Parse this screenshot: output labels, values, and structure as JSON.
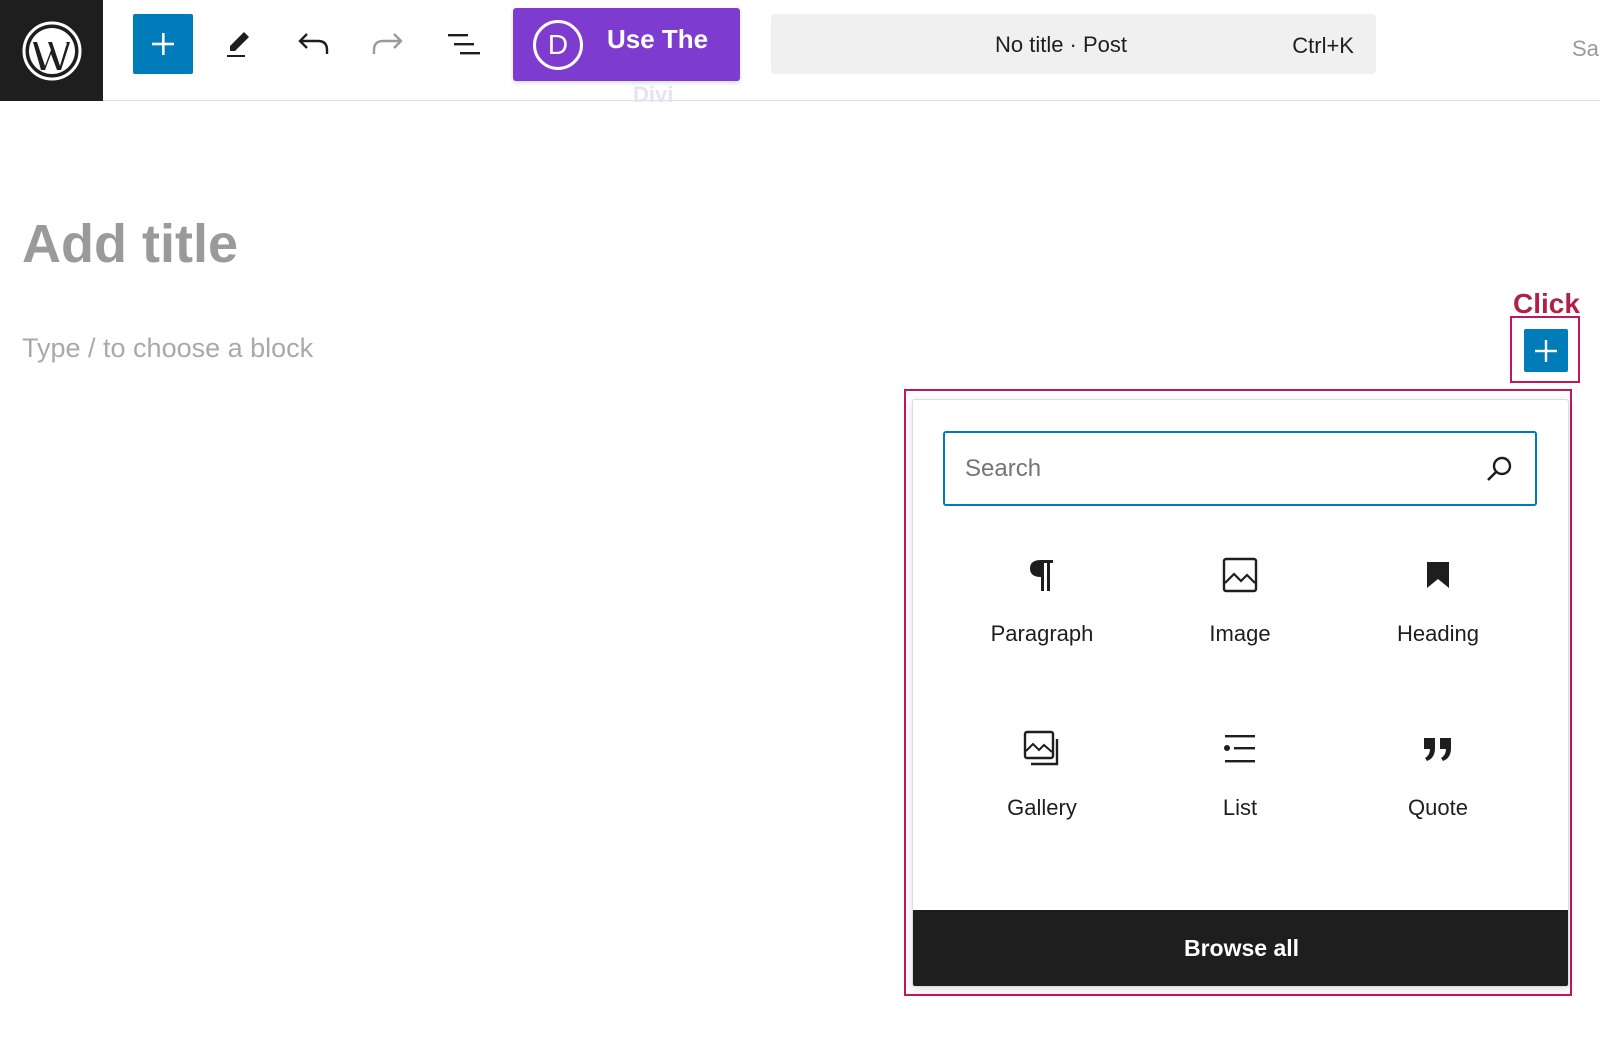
{
  "topbar": {
    "add_block_icon": "plus-icon",
    "tools_icon": "pencil-icon",
    "undo_icon": "undo-icon",
    "redo_icon": "redo-icon",
    "document_overview_icon": "list-view-icon",
    "divi_button": {
      "logo_letter": "D",
      "label_line1": "Use The",
      "label_line2": "Divi"
    },
    "command_bar": {
      "title": "No title · Post",
      "shortcut": "Ctrl+K"
    },
    "save_partial": "Sa"
  },
  "editor": {
    "title_placeholder": "Add title",
    "block_placeholder": "Type / to choose a block"
  },
  "annotation": {
    "click_label": "Click",
    "color": "#c2185b"
  },
  "inserter": {
    "search_placeholder": "Search",
    "search_value": "",
    "blocks": [
      {
        "label": "Paragraph",
        "icon": "paragraph-icon"
      },
      {
        "label": "Image",
        "icon": "image-icon"
      },
      {
        "label": "Heading",
        "icon": "heading-bookmark-icon"
      },
      {
        "label": "Gallery",
        "icon": "gallery-icon"
      },
      {
        "label": "List",
        "icon": "list-icon"
      },
      {
        "label": "Quote",
        "icon": "quote-icon"
      }
    ],
    "browse_all_label": "Browse all"
  },
  "colors": {
    "accent": "#007cba",
    "divi_purple": "#7e3bd0",
    "dark": "#1e1e1e"
  }
}
